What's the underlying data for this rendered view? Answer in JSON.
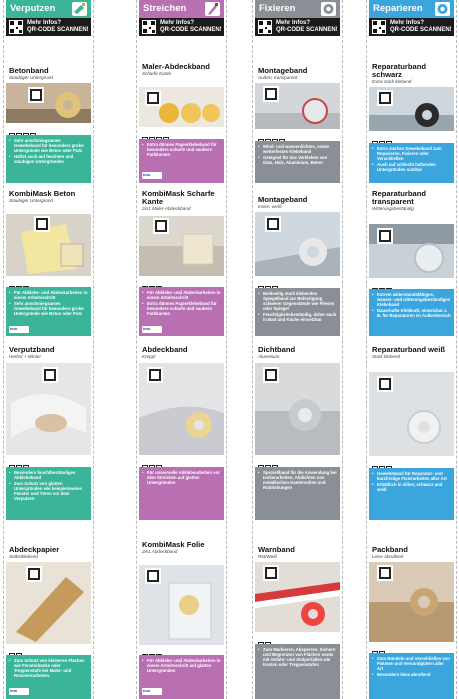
{
  "qr_banner": {
    "line1": "Mehr Infos?",
    "line2": "QR-CODE SCANNEN!"
  },
  "columns": [
    {
      "category": "Verputzen",
      "color": "#3ab59a",
      "icon": "trowel-icon",
      "products": [
        {
          "title": "Betonband",
          "subtitle": "Staubiger Untergrund",
          "bullets": [
            "Sehr anschmiegsames Gewebeband für besonders grobe Untergründe wie Beton oder Putz",
            "Haftet auch auf feuchten und staubigen Untergründen"
          ]
        },
        {
          "title": "KombiMask Beton",
          "subtitle": "Staubiger Untergrund",
          "bullets": [
            "Für Abklebe- und Abdeckarbeiten in einem Arbeitsschritt",
            "Sehr anschmiegsames Gewebeband für besonders grobe Untergründe wie Beton oder Putz"
          ]
        },
        {
          "title": "Verputzband",
          "subtitle": "Herbst + Winter",
          "bullets": [
            "Besonders feuchtbeständiges Abklebeband",
            "Zum Schutz von glatten Untergründen wie beispielsweise Fenster und Türen vor dem Verputzen"
          ]
        },
        {
          "title": "Abdeckpapier",
          "subtitle": "Selbstklebend",
          "bullets": [
            "Zum Schutz von kleineren Flächen wie Fensterbänke oder Treppenstufe bei Maler- und Renovierarbeiten."
          ]
        }
      ]
    },
    {
      "category": "Streichen",
      "color": "#b970b3",
      "icon": "paintbrush-icon",
      "products": [
        {
          "title": "Maler-Abdeckband",
          "subtitle": "Scharfe Kante",
          "bullets": [
            "Extra dünnes Papierklebeband für besonders scharfe und saubere Farbkanten"
          ]
        },
        {
          "title": "KombiMask Scharfe Kante",
          "subtitle": "2in1 Maler-Abdeckband",
          "bullets": [
            "Für Abklebe- und Abdeckarbeiten in einem Arbeitsschritt",
            "Extra dünnes Papierklebeband für besonders scharfe und saubere Farbkanten"
          ]
        },
        {
          "title": "Abdeckband",
          "subtitle": "Kreppl",
          "bullets": [
            "Für universelle Abklebearbeiten vor dem Streichen auf glatten Untergründen"
          ]
        },
        {
          "title": "KombiMask Folie",
          "subtitle": "2in1 Abdeckband",
          "bullets": [
            "Für Abklebe- und Abdeckarbeiten in einem Arbeitsschritt auf glatten Untergründen"
          ]
        }
      ]
    },
    {
      "category": "Fixieren",
      "color": "#8a8f96",
      "icon": "tape-roll-icon",
      "products": [
        {
          "title": "Montageband",
          "subtitle": "Außen, transparent",
          "bullets": [
            "Wind- und wasserdichtes, sowie wetterfestes Klebeband",
            "Geeignet für das Verkleben von Glas, Holz, Aluminium, Beton"
          ]
        },
        {
          "title": "Montageband",
          "subtitle": "Innen, weiß",
          "bullets": [
            "Beidseitig stark klebendes Spiegelband zur Befestigung schwerer Gegenstände wie Fliesen oder Spiegel",
            "Feuchtigkeitsbeständig, daher auch in Bad und Küche einsetzbar"
          ]
        },
        {
          "title": "Dichtband",
          "subtitle": "Aluminium",
          "bullets": [
            "Speziellband für die Anwendung bei Isolierarbeiten, Abdichten von metallischen Kantenrollen und Rohrleitungen"
          ]
        },
        {
          "title": "Warnband",
          "subtitle": "Rot/Weiß",
          "bullets": [
            "Zum Markieren, Absperren, Sichern und Begrenzen von Flächen sowie mit Gefahr- und Stolperfallen wie Kanten oder Treppenstufen"
          ]
        }
      ]
    },
    {
      "category": "Reparieren",
      "color": "#3aa6dd",
      "icon": "tape-roll-icon",
      "products": [
        {
          "title": "Reparaturband schwarz",
          "subtitle": "Extra stark klebend",
          "bullets": [
            "Extra starkes Gewebeband zum Reparieren, Fixieren oder Verschließen",
            "Auch auf schlecht haftenden Untergründen nutzbar"
          ]
        },
        {
          "title": "Reparaturband transparent",
          "subtitle": "Witterungsbeständig",
          "bullets": [
            "Extrem widerstandsfähiges, wasser- und witterungsbeständiges Klebeband",
            "Dauerhafte Klebkraft, einsetzbar z. B. für Reparaturen im Außenbereich"
          ]
        },
        {
          "title": "Reparaturband weiß",
          "subtitle": "Stark klebend",
          "bullets": [
            "Gewebeband für Reparatur- und kurzfristige Fixierarbeiten aller Art",
            "Erhältlich in silber, schwarz und weiß"
          ]
        },
        {
          "title": "Packband",
          "subtitle": "Leise abrollend",
          "bullets": [
            "Zum Bündeln und Verschließen von Paketen und Versandgütern aller Art",
            "Besonders leise abrollend"
          ]
        }
      ]
    }
  ]
}
